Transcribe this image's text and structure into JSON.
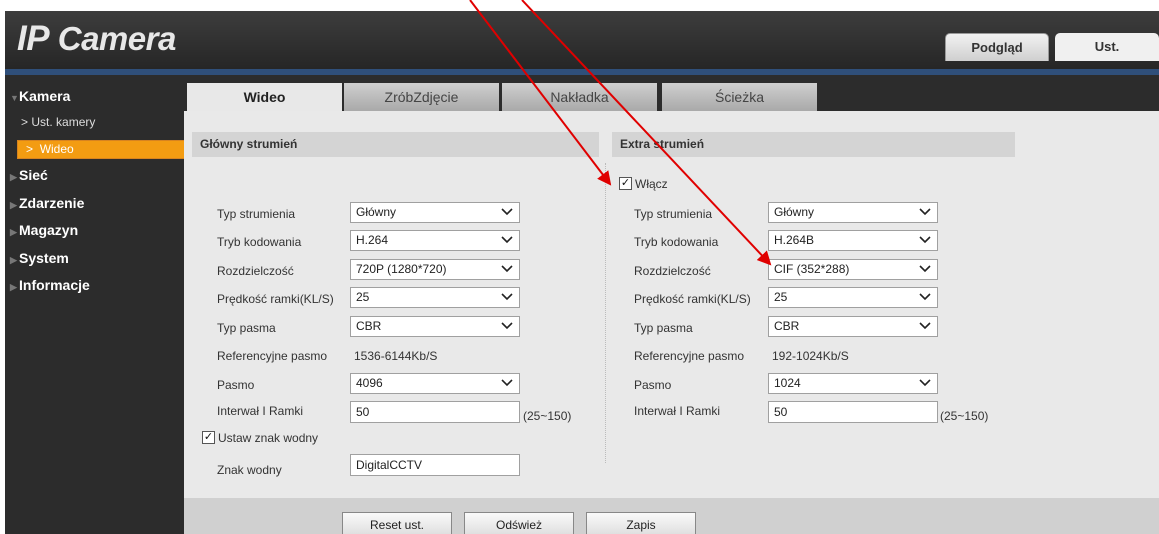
{
  "app": {
    "title_prefix": "IP",
    "title_rest": "Camera"
  },
  "top_tabs": {
    "preview": "Podgląd",
    "settings": "Ust."
  },
  "sidebar": {
    "camera": "Kamera",
    "camera_settings": "Ust. kamery",
    "video": "Wideo",
    "network": "Sieć",
    "event": "Zdarzenie",
    "storage": "Magazyn",
    "system": "System",
    "info": "Informacje"
  },
  "sub_tabs": [
    "Wideo",
    "ZróbZdjęcie",
    "Nakładka",
    "Ścieżka"
  ],
  "main_stream": {
    "title": "Główny strumień",
    "labels": {
      "stream_type": "Typ strumienia",
      "encoding": "Tryb kodowania",
      "resolution": "Rozdzielczość",
      "frame_rate": "Prędkość ramki(KL/S)",
      "bitrate_type": "Typ pasma",
      "ref_bitrate": "Referencyjne pasmo",
      "bitrate": "Pasmo",
      "i_frame": "Interwał I Ramki"
    },
    "values": {
      "stream_type": "Główny",
      "encoding": "H.264",
      "resolution": "720P (1280*720)",
      "frame_rate": "25",
      "bitrate_type": "CBR",
      "ref_bitrate": "1536-6144Kb/S",
      "bitrate": "4096",
      "i_frame": "50",
      "i_frame_range": "(25~150)"
    },
    "watermark_check_label": "Ustaw znak wodny",
    "watermark_label": "Znak wodny",
    "watermark_value": "DigitalCCTV"
  },
  "extra_stream": {
    "title": "Extra strumień",
    "enable_label": "Włącz",
    "labels": {
      "stream_type": "Typ strumienia",
      "encoding": "Tryb kodowania",
      "resolution": "Rozdzielczość",
      "frame_rate": "Prędkość ramki(KL/S)",
      "bitrate_type": "Typ pasma",
      "ref_bitrate": "Referencyjne pasmo",
      "bitrate": "Pasmo",
      "i_frame": "Interwał I Ramki"
    },
    "values": {
      "stream_type": "Główny",
      "encoding": "H.264B",
      "resolution": "CIF (352*288)",
      "frame_rate": "25",
      "bitrate_type": "CBR",
      "ref_bitrate": "192-1024Kb/S",
      "bitrate": "1024",
      "i_frame": "50",
      "i_frame_range": "(25~150)"
    }
  },
  "buttons": {
    "reset": "Reset ust.",
    "refresh": "Odśwież",
    "save": "Zapis"
  },
  "colors": {
    "accent": "#f39c12",
    "annotation": "#e00000",
    "header": "#2c2c2c"
  }
}
